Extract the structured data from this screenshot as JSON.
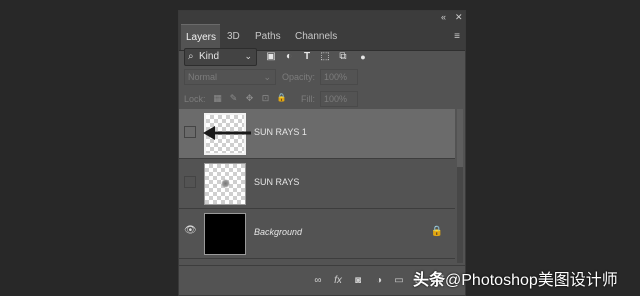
{
  "window": {
    "collapse": "«",
    "close": "✕",
    "menu": "≡"
  },
  "tabs": [
    "Layers",
    "3D",
    "Paths",
    "Channels"
  ],
  "filter": {
    "search_glyph": "⌕",
    "kind_label": "Kind",
    "chevron": "⌄",
    "icons": [
      {
        "name": "image-filter-icon",
        "glyph": "▣"
      },
      {
        "name": "adjustment-filter-icon",
        "glyph": "◐"
      },
      {
        "name": "type-filter-icon",
        "glyph": "T"
      },
      {
        "name": "shape-filter-icon",
        "glyph": "⬚"
      },
      {
        "name": "smart-object-filter-icon",
        "glyph": "⧉"
      },
      {
        "name": "filter-toggle-icon",
        "glyph": "●"
      }
    ]
  },
  "blend": {
    "mode": "Normal",
    "opacity_label": "Opacity:",
    "opacity_value": "100%",
    "chevron": "⌄"
  },
  "locks": {
    "label": "Lock:",
    "icons": [
      {
        "name": "lock-transparent-icon",
        "glyph": "▦"
      },
      {
        "name": "lock-paint-icon",
        "glyph": "✎"
      },
      {
        "name": "lock-position-icon",
        "glyph": "✥"
      },
      {
        "name": "lock-artboard-icon",
        "glyph": "⊡"
      },
      {
        "name": "lock-all-icon",
        "glyph": "🔒"
      }
    ],
    "fill_label": "Fill:",
    "fill_value": "100%"
  },
  "layers": [
    {
      "name": "SUN RAYS 1",
      "selected": true,
      "visible": false,
      "thumb": "checker-selected"
    },
    {
      "name": "SUN RAYS",
      "selected": false,
      "visible": false,
      "thumb": "checker-blob"
    },
    {
      "name": "Background",
      "selected": false,
      "visible": true,
      "thumb": "black",
      "locked": true
    }
  ],
  "layer_glyphs": {
    "eye": "👁",
    "lock": "🔒"
  },
  "bottom_icons": [
    {
      "name": "link-layers-icon",
      "glyph": "∞"
    },
    {
      "name": "fx-icon",
      "glyph": "fx"
    },
    {
      "name": "add-mask-icon",
      "glyph": "◙"
    },
    {
      "name": "adjustment-layer-icon",
      "glyph": "◑"
    },
    {
      "name": "new-group-icon",
      "glyph": "▭"
    },
    {
      "name": "new-layer-icon",
      "glyph": "⊞"
    },
    {
      "name": "delete-layer-icon",
      "glyph": "🗑"
    }
  ],
  "watermark": {
    "brand": "头条",
    "text": "@Photoshop美图设计师"
  }
}
